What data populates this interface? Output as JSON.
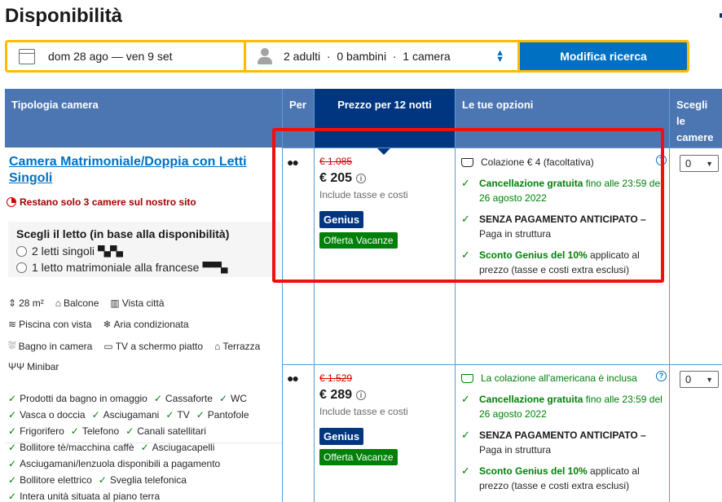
{
  "page": {
    "title": "Disponibilità"
  },
  "search": {
    "dates": "dom 28 ago — ven 9 set",
    "guests": "2 adulti  ·  0 bambini  ·  1 camera",
    "button": "Modifica ricerca"
  },
  "table": {
    "headers": {
      "room_type": "Tipologia camera",
      "per": "Per",
      "price": "Prezzo per 12 notti",
      "options": "Le tue opzioni",
      "choose": "Scegli le camere"
    }
  },
  "room": {
    "name": "Camera Matrimoniale/Doppia con Letti Singoli",
    "scarcity": "Restano solo 3 camere sul nostro sito",
    "bed_title": "Scegli il letto (in base alla disponibilità)",
    "bed_options": [
      "2 letti singoli",
      "1 letto matrimoniale alla francese"
    ],
    "facilities": [
      [
        "28 m²",
        "Balcone",
        "Vista città"
      ],
      [
        "Piscina con vista",
        "Aria condizionata"
      ],
      [
        "Bagno in camera",
        "TV a schermo piatto",
        "Terrazza"
      ],
      [
        "Minibar"
      ]
    ],
    "amenities": [
      [
        "Prodotti da bagno in omaggio",
        "Cassaforte",
        "WC"
      ],
      [
        "Vasca o doccia",
        "Asciugamani",
        "TV",
        "Pantofole"
      ],
      [
        "Frigorifero",
        "Telefono",
        "Canali satellitari"
      ],
      [
        "Bollitore tè/macchina caffè",
        "Asciugacapelli"
      ],
      [
        "Asciugamani/lenzuola disponibili a pagamento"
      ],
      [
        "Bollitore elettrico",
        "Sveglia telefonica"
      ],
      [
        "Intera unità situata al piano terra"
      ]
    ]
  },
  "offers": [
    {
      "original_price": "€ 1.085",
      "price": "€ 205",
      "includes": "Include tasse e costi",
      "genius": "Genius",
      "offer": "Offerta Vacanze",
      "breakfast": "Colazione € 4 (facoltativa)",
      "cancel_bold": "Cancellazione gratuita",
      "cancel_rest": " fino alle 23:59 del 26 agosto 2022",
      "prepay_bold": "SENZA PAGAMENTO ANTICIPATO –",
      "prepay_rest": "Paga in struttura",
      "discount_bold": "Sconto Genius del 10%",
      "discount_rest": " applicato al prezzo (tasse e costi extra esclusi)",
      "select_value": "0"
    },
    {
      "original_price": "€ 1.529",
      "price": "€ 289",
      "includes": "Include tasse e costi",
      "genius": "Genius",
      "offer": "Offerta Vacanze",
      "breakfast": "La colazione all'americana è inclusa",
      "cancel_bold": "Cancellazione gratuita",
      "cancel_rest": " fino alle 23:59 del 26 agosto 2022",
      "prepay_bold": "SENZA PAGAMENTO ANTICIPATO –",
      "prepay_rest": "Paga in struttura",
      "discount_bold": "Sconto Genius del 10%",
      "discount_rest": " applicato al prezzo (tasse e costi extra esclusi)",
      "select_value": "0"
    }
  ],
  "colors": {
    "brand_blue": "#003580",
    "link_blue": "#0071c2",
    "header_blue": "#4c76b2",
    "green": "#008009",
    "yellow": "#febb02",
    "highlight_red": "#f01010"
  }
}
